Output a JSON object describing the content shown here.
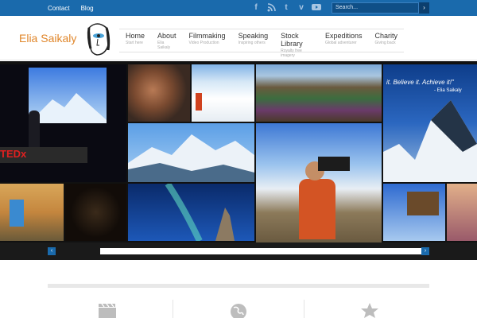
{
  "topbar": {
    "links": [
      "Contact",
      "Blog"
    ],
    "social_icons": [
      "facebook-icon",
      "rss-icon",
      "twitter-icon",
      "vimeo-icon",
      "youtube-icon"
    ],
    "search_placeholder": "Search...",
    "search_button": "›"
  },
  "header": {
    "logo_text": "Elia Saikaly",
    "menu": [
      {
        "title": "Home",
        "sub": "Start here"
      },
      {
        "title": "About",
        "sub": "Elia Saikaly"
      },
      {
        "title": "Filmmaking",
        "sub": "Video Production"
      },
      {
        "title": "Speaking",
        "sub": "Inspiring others"
      },
      {
        "title": "Stock Library",
        "sub": "Royalty free imagery"
      },
      {
        "title": "Expeditions",
        "sub": "Global adventurer"
      },
      {
        "title": "Charity",
        "sub": "Giving back"
      }
    ]
  },
  "gallery": {
    "tedx_text": "TEDx",
    "quote": "it. Believe it. Achieve it!\"",
    "quote_author": "- Elia Saikaly",
    "prev_label": "‹",
    "next_label": "›"
  },
  "features": {
    "icons": [
      "film-clapper-icon",
      "globe-icon",
      "star-icon"
    ]
  },
  "colors": {
    "accent": "#1a6aac",
    "logo": "#e0862a"
  }
}
